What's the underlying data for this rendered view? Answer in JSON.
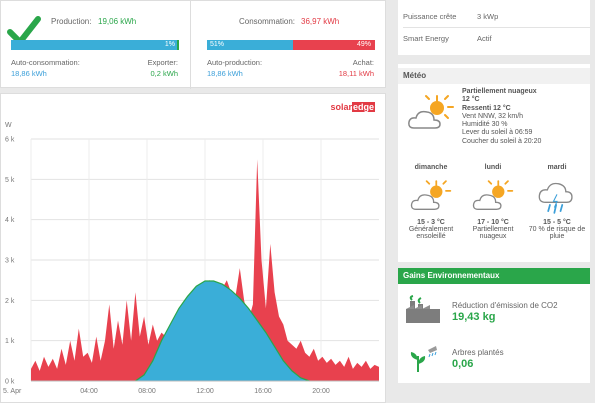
{
  "production": {
    "label": "Production:",
    "value": "19,06 kWh",
    "self_consumption_label": "Auto-consommation:",
    "self_consumption_value": "18,86 kWh",
    "export_label": "Exporter:",
    "export_value": "0,2 kWh",
    "bar_percent_label": "1%",
    "self_share": 0.99
  },
  "consumption": {
    "label": "Consommation:",
    "value": "36,97 kWh",
    "self_pct_label": "51%",
    "import_pct_label": "49%",
    "self_share": 0.51,
    "self_production_label": "Auto-production:",
    "self_production_value": "18,86 kWh",
    "purchase_label": "Achat:",
    "purchase_value": "18,11 kWh"
  },
  "brand": {
    "part1": "solar",
    "part2": "edge"
  },
  "site": {
    "peak_power_label": "Puissance crête",
    "peak_power_value": "3 kWp",
    "smart_energy_label": "Smart Energy",
    "smart_energy_value": "Actif"
  },
  "weather": {
    "title": "Météo",
    "current": {
      "condition": "Partiellement nuageux",
      "temp": "12 °C",
      "feels_like": "Ressenti 12 °C",
      "wind": "Vent NNW, 32 km/h",
      "humidity": "Humidité 30 %",
      "sunrise": "Lever du soleil à 06:59",
      "sunset": "Coucher du soleil à 20:20"
    },
    "forecast": [
      {
        "day": "dimanche",
        "temps": "15 - 3 °C",
        "desc1": "Généralement",
        "desc2": "ensoleillé",
        "icon": "partly-sunny-icon"
      },
      {
        "day": "lundi",
        "temps": "17 - 10 °C",
        "desc1": "Partiellement",
        "desc2": "nuageux",
        "icon": "partly-sunny-icon"
      },
      {
        "day": "mardi",
        "temps": "15 - 5 °C",
        "desc1": "70 % de risque de",
        "desc2": "pluie",
        "icon": "rain-icon"
      }
    ]
  },
  "environment": {
    "title": "Gains Environnementaux",
    "co2_label": "Réduction d'émission de CO2",
    "co2_value": "19,43 kg",
    "trees_label": "Arbres plantés",
    "trees_value": "0,06"
  },
  "colors": {
    "production": "#3aaed8",
    "consumption": "#e8414e",
    "self": "#2aa64a",
    "env_header": "#2aa64a",
    "sun": "#f5a623"
  },
  "chart_data": {
    "type": "area",
    "ylabel": "W",
    "y_ticks": [
      "6 k",
      "5 k",
      "4 k",
      "3 k",
      "2 k",
      "1 k",
      "0 k"
    ],
    "x_ticks": [
      "5. Apr",
      "04:00",
      "08:00",
      "12:00",
      "16:00",
      "20:00"
    ],
    "ylim": [
      0,
      6000
    ],
    "xlim": [
      0,
      24
    ],
    "series": [
      {
        "key": "consumption",
        "x": [
          0,
          0.3,
          0.6,
          0.9,
          1.2,
          1.5,
          1.8,
          2.1,
          2.4,
          2.7,
          3.0,
          3.3,
          3.6,
          3.9,
          4.2,
          4.5,
          4.8,
          5.1,
          5.4,
          5.7,
          6.0,
          6.3,
          6.6,
          6.9,
          7.2,
          7.5,
          7.8,
          8.1,
          8.4,
          8.7,
          9.0,
          9.3,
          9.6,
          9.9,
          10.2,
          10.5,
          10.8,
          11.1,
          11.4,
          11.7,
          12.0,
          12.3,
          12.6,
          12.9,
          13.2,
          13.5,
          13.8,
          14.1,
          14.4,
          14.7,
          15.0,
          15.3,
          15.6,
          15.9,
          16.2,
          16.5,
          16.8,
          17.1,
          17.4,
          17.7,
          18.0,
          18.3,
          18.6,
          18.9,
          19.2,
          19.5,
          19.8,
          20.1,
          20.4,
          20.7,
          21.0,
          21.3,
          21.6,
          21.9,
          22.2,
          22.5,
          22.8,
          23.1,
          23.4,
          23.7,
          24.0
        ],
        "values": [
          300,
          500,
          250,
          600,
          350,
          550,
          300,
          800,
          400,
          1000,
          500,
          1300,
          600,
          700,
          450,
          1100,
          500,
          1000,
          1900,
          800,
          1500,
          900,
          2000,
          1000,
          2200,
          1100,
          1600,
          900,
          1400,
          1000,
          1200,
          1100,
          1300,
          1200,
          1600,
          1800,
          1900,
          2100,
          2300,
          2400,
          2450,
          2500,
          2450,
          2400,
          2300,
          2500,
          2200,
          2100,
          2800,
          2000,
          1500,
          1900,
          5500,
          3000,
          1800,
          3400,
          2200,
          1600,
          1400,
          1000,
          900,
          800,
          1000,
          700,
          600,
          800,
          500,
          600,
          450,
          550,
          400,
          500,
          350,
          600,
          300,
          450,
          350,
          500,
          300,
          400,
          350
        ]
      },
      {
        "key": "production",
        "x": [
          7.2,
          7.8,
          8.4,
          9.0,
          9.6,
          10.2,
          10.8,
          11.4,
          12.0,
          12.6,
          13.2,
          13.8,
          14.4,
          15.0,
          15.6,
          16.2,
          16.8,
          17.4,
          18.0,
          18.6,
          19.2
        ],
        "values": [
          0,
          150,
          500,
          1000,
          1400,
          1800,
          2100,
          2350,
          2480,
          2480,
          2400,
          2250,
          2050,
          1800,
          1500,
          1200,
          850,
          500,
          250,
          80,
          0
        ]
      }
    ]
  }
}
